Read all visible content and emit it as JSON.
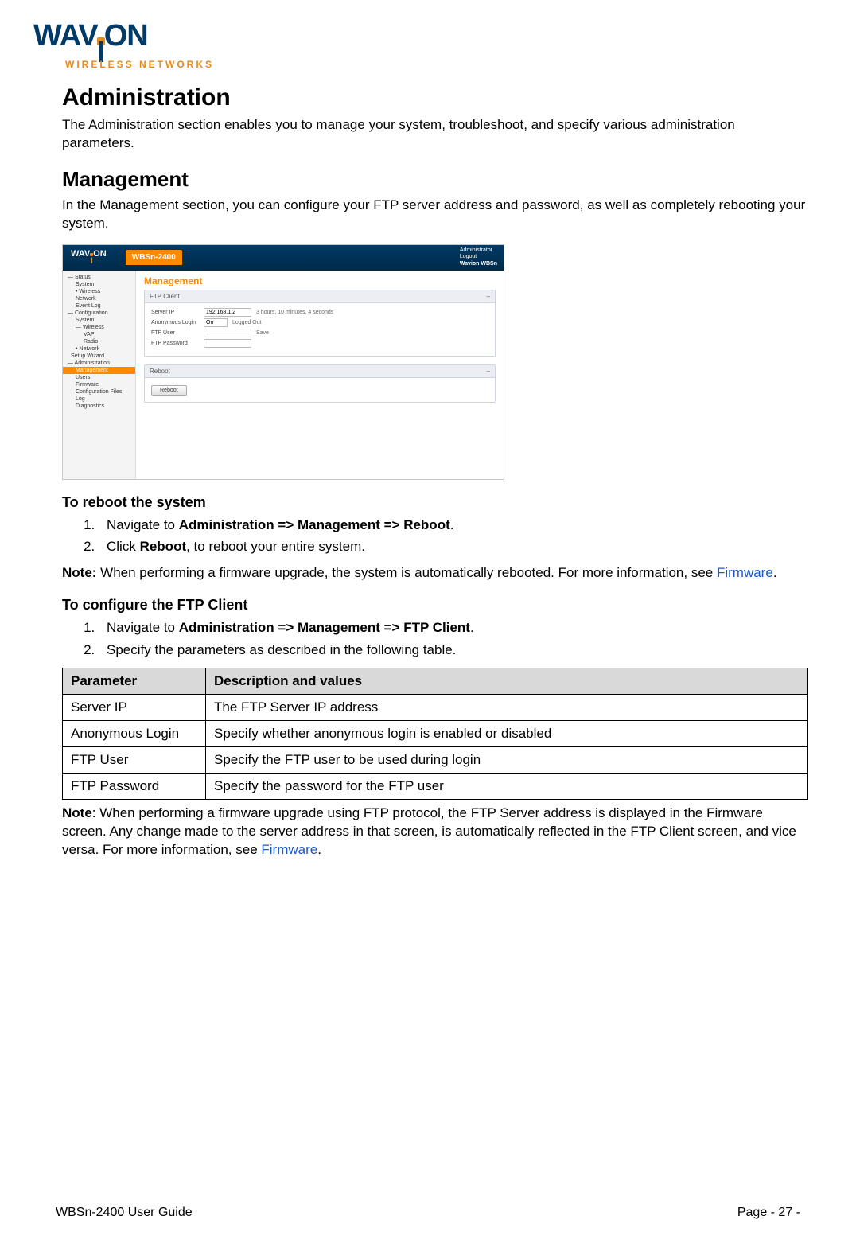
{
  "logo": {
    "name_left": "WAV",
    "name_right": "ON",
    "tagline": "WIRELESS NETWORKS"
  },
  "h1": "Administration",
  "p1": "The Administration section enables you to manage your system, troubleshoot, and specify various administration parameters.",
  "h2": "Management",
  "p2": "In the Management section, you can configure your FTP server address and password, as well as completely rebooting your system.",
  "screenshot": {
    "product_tab": "WBSn-2400",
    "top_right_l1": "Administrator",
    "top_right_l2": "Logout",
    "top_right_l3": "Wavion WBSn",
    "nav": {
      "status": "— Status",
      "system": "System",
      "wireless": "• Wireless",
      "network": "Network",
      "eventlog": "Event Log",
      "config": "— Configuration",
      "system2": "System",
      "wireless2": "— Wireless",
      "vap": "VAP",
      "radio": "Radio",
      "network2": "• Network",
      "setupwiz": "Setup Wizard",
      "admin": "— Administration",
      "management": "Management",
      "users": "Users",
      "firmware": "Firmware",
      "cfgfiles": "Configuration Files",
      "log": "Log",
      "diag": "Diagnostics"
    },
    "panel_title": "Management",
    "ftp_panel_head": "FTP Client",
    "server_ip_label": "Server IP",
    "server_ip_value": "192.168.1.2",
    "server_ip_hint": "3 hours, 10 minutes, 4 seconds",
    "anon_label": "Anonymous Login",
    "anon_value": "On",
    "logged": "Logged Out",
    "ftpuser_label": "FTP User",
    "ftpuser_hint": "Save",
    "ftppass_label": "FTP Password",
    "reboot_panel_head": "Reboot",
    "reboot_btn": "Reboot"
  },
  "reboot": {
    "title": "To reboot the system",
    "step1_pre": "Navigate to ",
    "step1_strong": "Administration => Management => Reboot",
    "step2_pre": "Click ",
    "step2_strong": "Reboot",
    "step2_post": ", to reboot your entire system."
  },
  "note1": {
    "label": "Note:",
    "body_a": " When performing a firmware upgrade, the system is automatically rebooted. For more information, see ",
    "link": "Firmware",
    "body_b": "."
  },
  "ftp": {
    "title": "To configure the FTP Client",
    "step1_pre": "Navigate to ",
    "step1_strong": "Administration => Management => FTP Client",
    "step2": "Specify the parameters as described in the following table."
  },
  "table": {
    "h1": "Parameter",
    "h2": "Description and values",
    "rows": [
      {
        "p": "Server IP",
        "d": "The FTP Server IP address"
      },
      {
        "p": "Anonymous Login",
        "d": "Specify whether anonymous login is enabled or disabled"
      },
      {
        "p": "FTP User",
        "d": "Specify the FTP user to be used during login"
      },
      {
        "p": "FTP Password",
        "d": "Specify the password for the FTP user"
      }
    ]
  },
  "note2": {
    "label": "Note",
    "body_a": ": When performing a firmware upgrade using FTP protocol, the FTP Server address is displayed in the Firmware screen. Any change made to the server address in that screen, is automatically reflected in the FTP Client screen, and vice versa. For more information, see ",
    "link": "Firmware",
    "body_b": "."
  },
  "footer": {
    "left": "WBSn-2400 User Guide",
    "right": "Page - 27 -"
  }
}
